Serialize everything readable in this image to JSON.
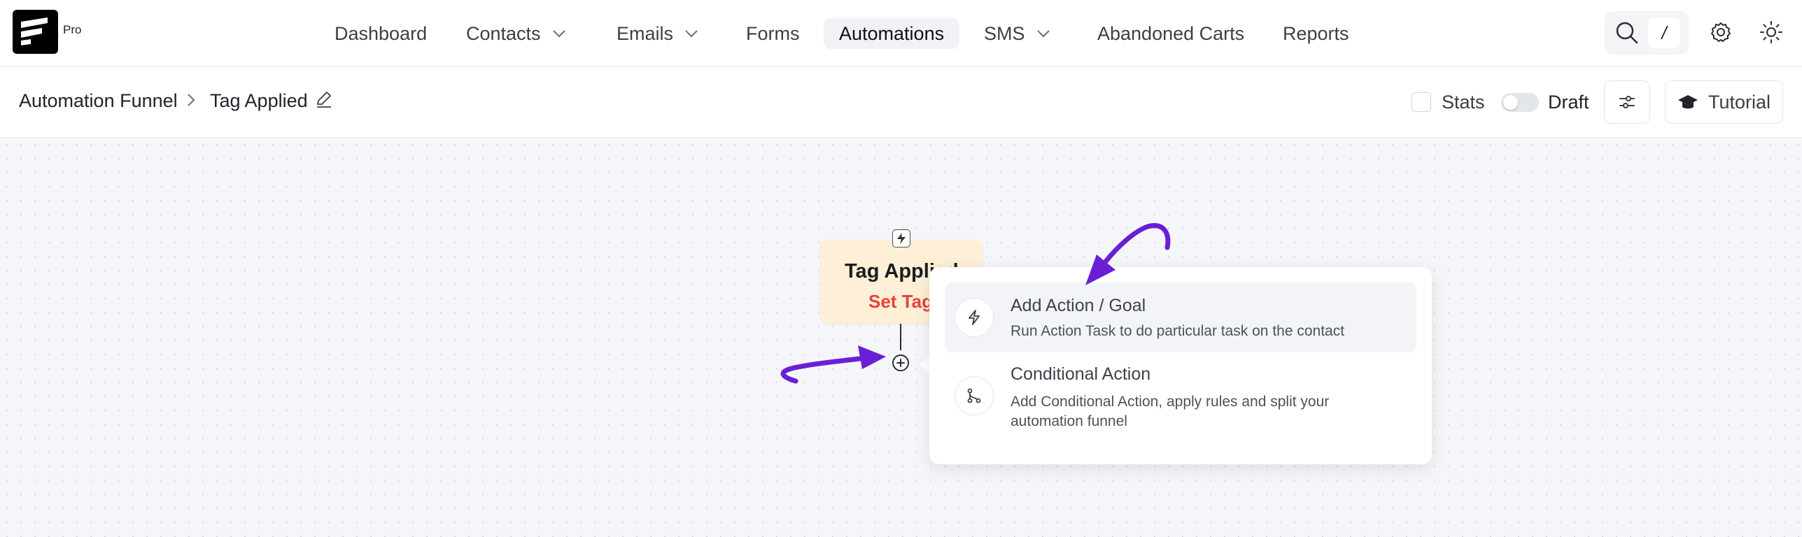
{
  "brand": {
    "plan_label": "Pro"
  },
  "nav": {
    "items": [
      {
        "label": "Dashboard"
      },
      {
        "label": "Contacts"
      },
      {
        "label": "Emails"
      },
      {
        "label": "Forms"
      },
      {
        "label": "Automations"
      },
      {
        "label": "SMS"
      },
      {
        "label": "Abandoned Carts"
      },
      {
        "label": "Reports"
      }
    ],
    "active": "Automations",
    "search_shortcut": "/"
  },
  "breadcrumb": {
    "root": "Automation Funnel",
    "current": "Tag Applied"
  },
  "controls": {
    "stats_label": "Stats",
    "stats_checked": false,
    "status_label": "Draft",
    "status_toggle_on": false,
    "tutorial_label": "Tutorial"
  },
  "funnel": {
    "trigger": {
      "title": "Tag Applied",
      "subtitle": "Set Tag"
    }
  },
  "add_menu": {
    "options": [
      {
        "title": "Add Action / Goal",
        "description": "Run Action Task to do particular task on the contact",
        "icon": "bolt-icon"
      },
      {
        "title": "Conditional Action",
        "description": "Add Conditional Action, apply rules and split your automation funnel",
        "icon": "branch-icon"
      }
    ]
  },
  "colors": {
    "accent_annotation": "#6a1fd6",
    "trigger_node_bg": "#fdf0d6",
    "trigger_subtitle": "#e8413b"
  }
}
